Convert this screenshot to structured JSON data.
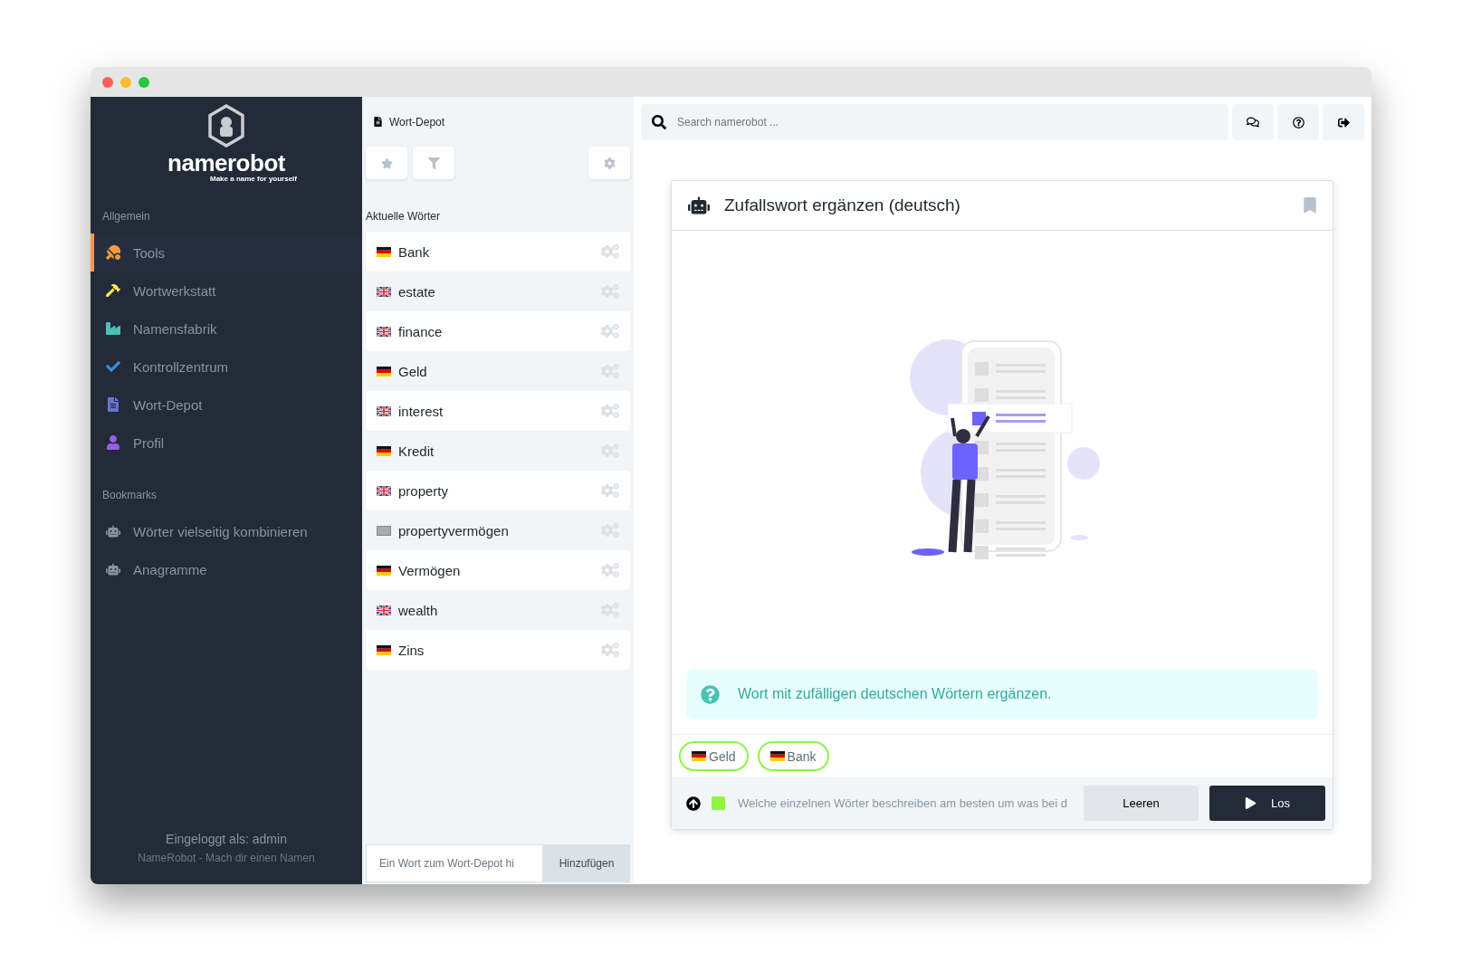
{
  "logo": {
    "name": "namerobot",
    "tagline": "Make a name for yourself"
  },
  "sidebar": {
    "sections": [
      {
        "title": "Allgemein",
        "items": [
          {
            "label": "Tools",
            "kind": "tools",
            "color": "#f6993f",
            "selected": true
          },
          {
            "label": "Wortwerkstatt",
            "kind": "hammer",
            "color": "#ffed4a",
            "selected": false
          },
          {
            "label": "Namensfabrik",
            "kind": "factory",
            "color": "#4dc0b5",
            "selected": false
          },
          {
            "label": "Kontrollzentrum",
            "kind": "check",
            "color": "#3490dc",
            "selected": false
          },
          {
            "label": "Wort-Depot",
            "kind": "file",
            "color": "#6574cd",
            "selected": false
          },
          {
            "label": "Profil",
            "kind": "user",
            "color": "#9561e2",
            "selected": false
          }
        ]
      },
      {
        "title": "Bookmarks",
        "items": [
          {
            "label": "Wörter vielseitig kombinieren",
            "kind": "robot",
            "color": "#8795a1",
            "selected": false
          },
          {
            "label": "Anagramme",
            "kind": "robot",
            "color": "#8795a1",
            "selected": false
          }
        ]
      }
    ],
    "footer": {
      "user": "Eingeloggt als: admin",
      "slogan": "NameRobot - Mach dir einen Namen"
    }
  },
  "depot": {
    "title": "Wort-Depot",
    "section": "Aktuelle Wörter",
    "words": [
      {
        "word": "Bank",
        "kind": "de"
      },
      {
        "word": "estate",
        "kind": "gb"
      },
      {
        "word": "finance",
        "kind": "gb"
      },
      {
        "word": "Geld",
        "kind": "de"
      },
      {
        "word": "interest",
        "kind": "gb"
      },
      {
        "word": "Kredit",
        "kind": "de"
      },
      {
        "word": "property",
        "kind": "gb"
      },
      {
        "word": "propertyvermögen",
        "kind": "unknown"
      },
      {
        "word": "Vermögen",
        "kind": "de"
      },
      {
        "word": "wealth",
        "kind": "gb"
      },
      {
        "word": "Zins",
        "kind": "de"
      }
    ],
    "input": {
      "placeholder": "Ein Wort zum Wort-Depot hi"
    },
    "add_button": "Hinzufügen"
  },
  "search": {
    "placeholder": "Search namerobot ..."
  },
  "tool": {
    "title": "Zufallswort ergänzen (deutsch)",
    "info": "Wort mit zufälligen deutschen Wörtern ergänzen.",
    "chips": [
      {
        "word": "Geld",
        "kind": "de"
      },
      {
        "word": "Bank",
        "kind": "de"
      }
    ],
    "input": {
      "placeholder": "Welche einzelnen Wörter beschreiben am besten um was bei d"
    },
    "clear_button": "Leeren",
    "run_button": "Los"
  }
}
